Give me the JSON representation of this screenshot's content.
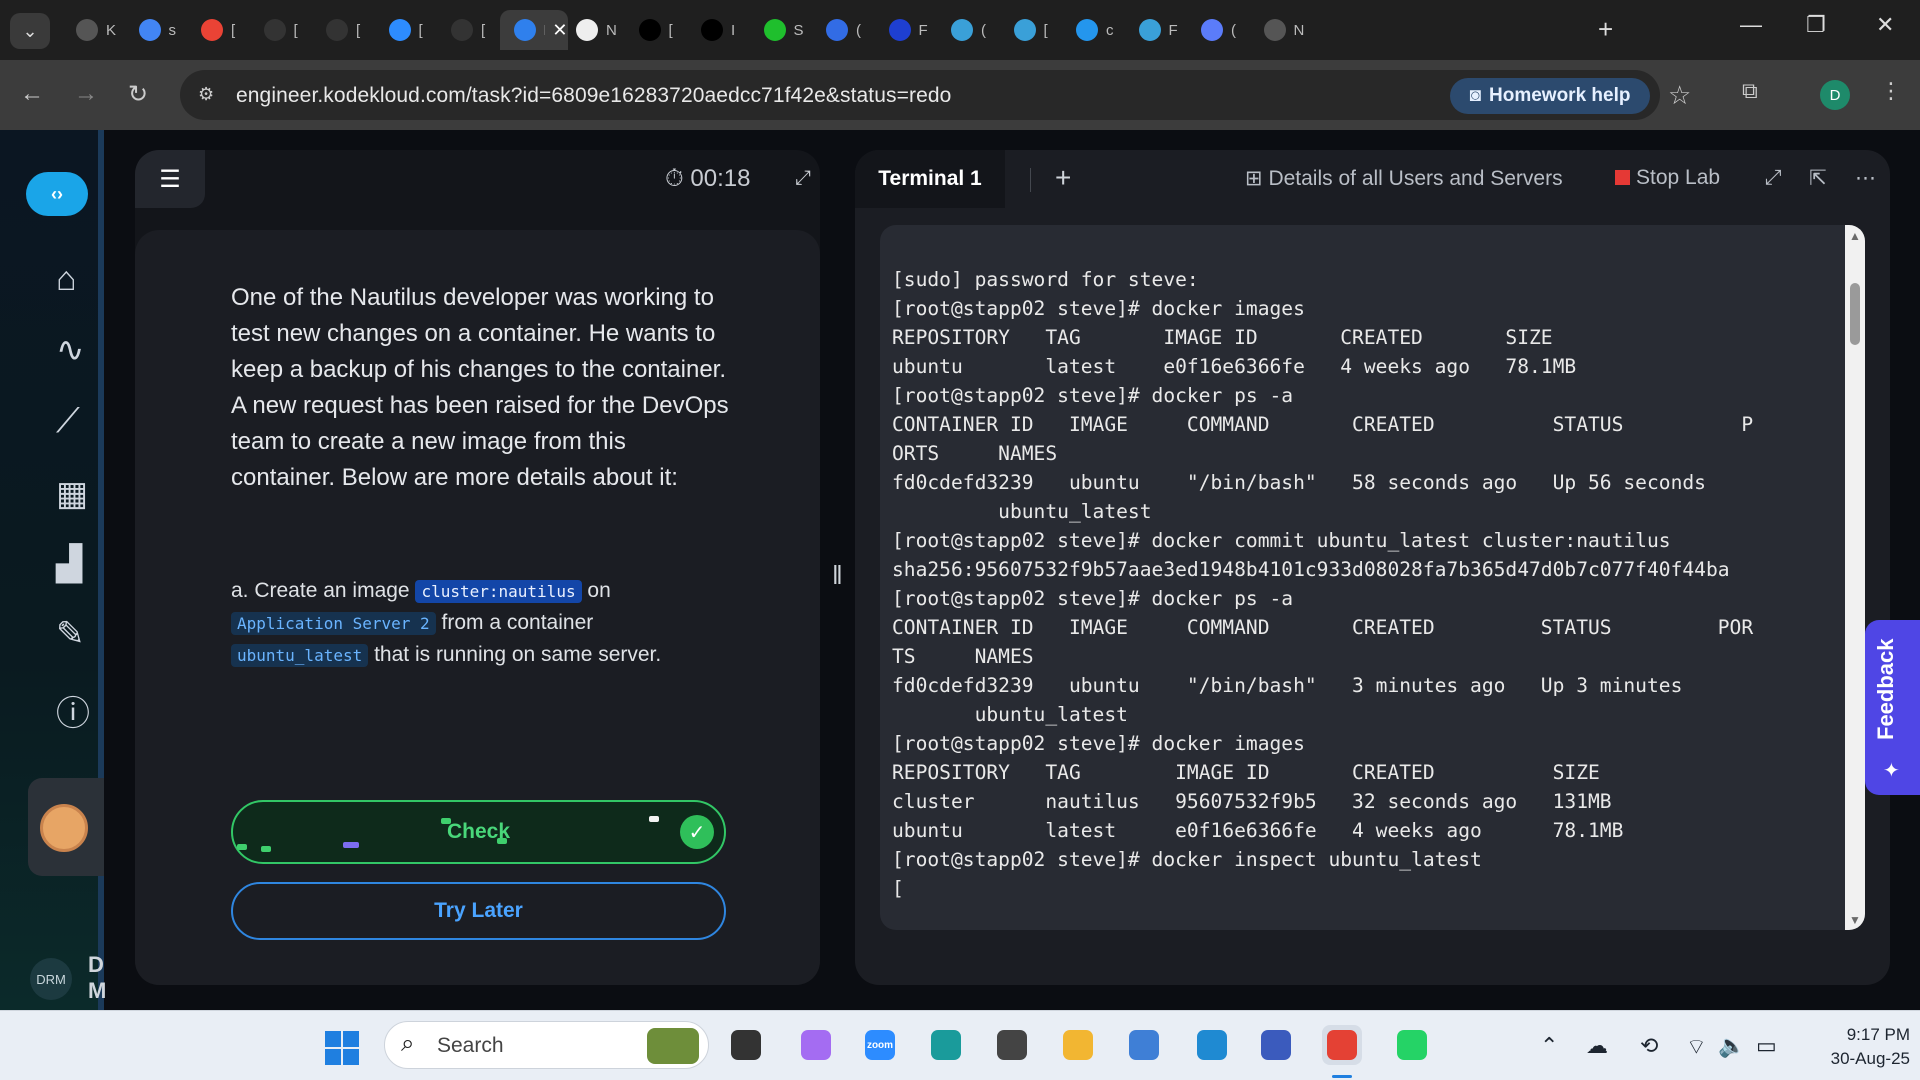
{
  "browser": {
    "tabs": [
      {
        "title": "K",
        "icon": "k-icon",
        "color": "#555"
      },
      {
        "title": "s",
        "icon": "google-icon",
        "color": "#4285f4"
      },
      {
        "title": "[",
        "icon": "gmail-icon",
        "color": "#ea4335"
      },
      {
        "title": "[",
        "icon": "github-icon",
        "color": "#333"
      },
      {
        "title": "[",
        "icon": "github-icon",
        "color": "#333"
      },
      {
        "title": "[",
        "icon": "zoom-icon",
        "color": "#2d8cff"
      },
      {
        "title": "[",
        "icon": "github-icon",
        "color": "#333"
      },
      {
        "title": "K",
        "icon": "kodekloud-icon",
        "color": "#2f80ed",
        "active": true
      },
      {
        "title": "N",
        "icon": "page-icon",
        "color": "#eee"
      },
      {
        "title": "[",
        "icon": "medium-icon",
        "color": "#000"
      },
      {
        "title": "I",
        "icon": "medium-icon",
        "color": "#000"
      },
      {
        "title": "S",
        "icon": "green-icon",
        "color": "#1fbf2d"
      },
      {
        "title": "(",
        "icon": "kubernetes-icon",
        "color": "#326ce5"
      },
      {
        "title": "F",
        "icon": "f-icon",
        "color": "#1e3fd1"
      },
      {
        "title": "(",
        "icon": "eye-icon",
        "color": "#3aa0d8"
      },
      {
        "title": "[",
        "icon": "eye-icon",
        "color": "#3aa0d8"
      },
      {
        "title": "c",
        "icon": "docker-icon",
        "color": "#2496ed"
      },
      {
        "title": "F",
        "icon": "eye-icon",
        "color": "#3aa0d8"
      },
      {
        "title": "(",
        "icon": "gemini-icon",
        "color": "#5b7cfa"
      },
      {
        "title": "N",
        "icon": "openai-icon",
        "color": "#555"
      }
    ],
    "url": "engineer.kodekloud.com/task?id=6809e16283720aedcc71f42e&status=redo",
    "homework_help": "Homework help",
    "profile_initial": "D"
  },
  "sidebar": {
    "user_initials": "DRM",
    "user_name_line1": "D",
    "user_name_line2": "M"
  },
  "task": {
    "timer": "00:18",
    "description": "One of the Nautilus developer was working to test new changes on a container. He wants to keep a backup of his changes to the container. A new request has been raised for the DevOps team to create a new image from this container. Below are more details about it:",
    "detail_prefix": "a. Create an image",
    "image_name": "cluster:nautilus",
    "detail_on": "on",
    "server": "Application Server 2",
    "detail_from": "from a container",
    "container": "ubuntu_latest",
    "detail_suffix": "that is running on same server.",
    "check_label": "Check",
    "try_later_label": "Try Later"
  },
  "terminal": {
    "tab_label": "Terminal 1",
    "details_label": "Details of all Users and Servers",
    "stop_label": "Stop Lab",
    "lines": [
      "[sudo] password for steve:",
      "[root@stapp02 steve]# docker images",
      "REPOSITORY   TAG       IMAGE ID       CREATED       SIZE",
      "ubuntu       latest    e0f16e6366fe   4 weeks ago   78.1MB",
      "[root@stapp02 steve]# docker ps -a",
      "CONTAINER ID   IMAGE     COMMAND       CREATED          STATUS          P",
      "ORTS     NAMES",
      "fd0cdefd3239   ubuntu    \"/bin/bash\"   58 seconds ago   Up 56 seconds",
      "         ubuntu_latest",
      "[root@stapp02 steve]# docker commit ubuntu_latest cluster:nautilus",
      "sha256:95607532f9b57aae3ed1948b4101c933d08028fa7b365d47d0b7c077f40f44ba",
      "[root@stapp02 steve]# docker ps -a",
      "CONTAINER ID   IMAGE     COMMAND       CREATED         STATUS         POR",
      "TS     NAMES",
      "fd0cdefd3239   ubuntu    \"/bin/bash\"   3 minutes ago   Up 3 minutes",
      "       ubuntu_latest",
      "[root@stapp02 steve]# docker images",
      "REPOSITORY   TAG        IMAGE ID       CREATED          SIZE",
      "cluster      nautilus   95607532f9b5   32 seconds ago   131MB",
      "ubuntu       latest     e0f16e6366fe   4 weeks ago      78.1MB",
      "[root@stapp02 steve]# docker inspect ubuntu_latest",
      "["
    ]
  },
  "feedback_label": "Feedback",
  "taskbar": {
    "search_label": "Search",
    "apps": [
      {
        "name": "taskview-icon",
        "color": "#333"
      },
      {
        "name": "copilot-icon",
        "color": "#a46cf2"
      },
      {
        "name": "zoom-icon",
        "color": "#2d8cff",
        "label": "zoom"
      },
      {
        "name": "edge-icon",
        "color": "#1a9b9b"
      },
      {
        "name": "snip-icon",
        "color": "#444"
      },
      {
        "name": "explorer-icon",
        "color": "#f2b632"
      },
      {
        "name": "notepad-icon",
        "color": "#3f7fd6"
      },
      {
        "name": "vscode-icon",
        "color": "#1f8ad2"
      },
      {
        "name": "network-app-icon",
        "color": "#3b5bbd"
      },
      {
        "name": "chrome-icon",
        "color": "#e44134",
        "active": true
      },
      {
        "name": "whatsapp-icon",
        "color": "#25d366"
      }
    ],
    "time": "9:17 PM",
    "date": "30-Aug-25"
  }
}
